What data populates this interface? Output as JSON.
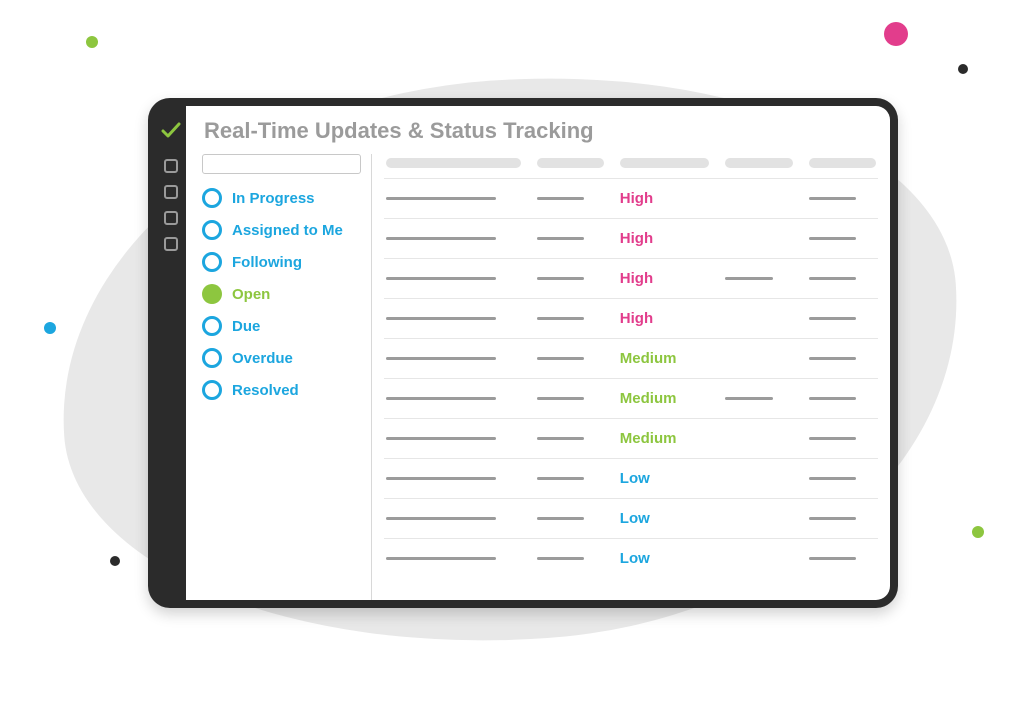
{
  "title": "Real-Time Updates & Status Tracking",
  "filters": [
    {
      "label": "In Progress",
      "active": false
    },
    {
      "label": "Assigned to Me",
      "active": false
    },
    {
      "label": "Following",
      "active": false
    },
    {
      "label": "Open",
      "active": true
    },
    {
      "label": "Due",
      "active": false
    },
    {
      "label": "Overdue",
      "active": false
    },
    {
      "label": "Resolved",
      "active": false
    }
  ],
  "rows": [
    {
      "priority": "High",
      "priorityClass": "prio-high",
      "col4": false
    },
    {
      "priority": "High",
      "priorityClass": "prio-high",
      "col4": false
    },
    {
      "priority": "High",
      "priorityClass": "prio-high",
      "col4": true
    },
    {
      "priority": "High",
      "priorityClass": "prio-high",
      "col4": false
    },
    {
      "priority": "Medium",
      "priorityClass": "prio-medium",
      "col4": false
    },
    {
      "priority": "Medium",
      "priorityClass": "prio-medium",
      "col4": true
    },
    {
      "priority": "Medium",
      "priorityClass": "prio-medium",
      "col4": false
    },
    {
      "priority": "Low",
      "priorityClass": "prio-low",
      "col4": false
    },
    {
      "priority": "Low",
      "priorityClass": "prio-low",
      "col4": false
    },
    {
      "priority": "Low",
      "priorityClass": "prio-low",
      "col4": false
    }
  ],
  "columns": 5
}
